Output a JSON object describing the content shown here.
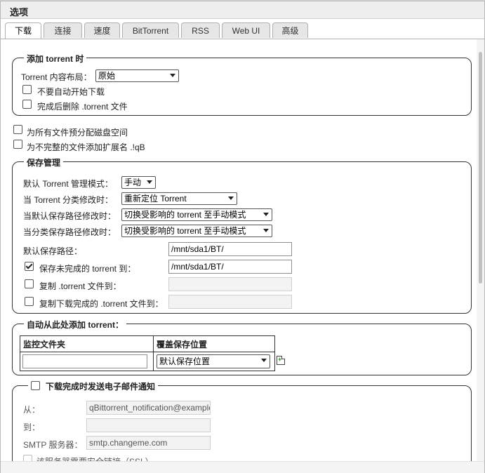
{
  "window": {
    "title": "选项"
  },
  "tabs": [
    "下载",
    "连接",
    "速度",
    "BitTorrent",
    "RSS",
    "Web UI",
    "高级"
  ],
  "add_torrent": {
    "legend": "添加 torrent 时",
    "layout_label": "Torrent 内容布局：",
    "layout_value": "原始",
    "dont_start_label": "不要自动开始下载",
    "delete_after_label": "完成后删除 .torrent 文件"
  },
  "prealloc_label": "为所有文件预分配磁盘空间",
  "append_ext_label": "为不完整的文件添加扩展名 .!qB",
  "save_mgmt": {
    "legend": "保存管理",
    "mode_label": "默认 Torrent 管理模式：",
    "mode_value": "手动",
    "cat_changed_label": "当 Torrent 分类修改时：",
    "cat_changed_value": "重新定位 Torrent",
    "default_path_changed_label": "当默认保存路径修改时：",
    "default_path_changed_value": "切换受影响的 torrent 至手动模式",
    "cat_path_changed_label": "当分类保存路径修改时：",
    "cat_path_changed_value": "切换受影响的 torrent 至手动模式",
    "default_save_path_label": "默认保存路径：",
    "default_save_path_value": "/mnt/sda1/BT/",
    "incomplete_label": "保存未完成的 torrent 到：",
    "incomplete_checked": true,
    "incomplete_value": "/mnt/sda1/BT/",
    "copy_torrent_label": "复制 .torrent 文件到：",
    "copy_finished_label": "复制下载完成的 .torrent 文件到："
  },
  "auto_add": {
    "legend": "自动从此处添加 torrent：",
    "col_folder": "监控文件夹",
    "col_override": "覆盖保存位置",
    "override_value": "默认保存位置"
  },
  "email": {
    "legend": "下载完成时发送电子邮件通知",
    "from_label": "从：",
    "from_value": "qBittorrent_notification@example.com",
    "to_label": "到：",
    "smtp_label": "SMTP 服务器：",
    "smtp_value": "smtp.changeme.com",
    "ssl_label": "该服务器需要安全链接（SSL）"
  }
}
